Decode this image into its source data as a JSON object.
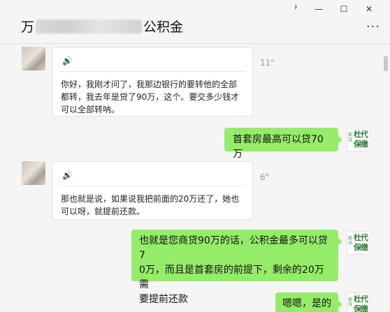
{
  "header": {
    "title_prefix": "万",
    "title_suffix": "公积金",
    "more_label": "···",
    "win_pin": "ᅡ",
    "win_min": "—",
    "win_max": "☐",
    "win_close": "✕"
  },
  "messages": [
    {
      "type": "incoming-voice",
      "voice_icon": "🔊",
      "duration": "11\"",
      "text": "你好，我刚才问了，我那边银行的要转他的全部都转，我去年是贷了90万，这个。要交多少钱才可以全部转呐。"
    },
    {
      "type": "outgoing",
      "text": "首套房最高可以贷70万"
    },
    {
      "type": "incoming-voice",
      "voice_icon": "🔊",
      "duration": "6\"",
      "text": "那也就是说，如果说我把前面的20万还了，她也可以呀，就提前还款。"
    },
    {
      "type": "outgoing",
      "text_line1": "也就是您商贷90万的话，公积金最多可以贷7",
      "text_line2": "0万，而且是首套房的前提下，剩余的20万需",
      "text_line3": "要提前还款"
    },
    {
      "type": "outgoing",
      "text": "嗯嗯，是的"
    }
  ],
  "self_avatar": {
    "small_text": "武汉",
    "big_text": "杜代保缴"
  }
}
